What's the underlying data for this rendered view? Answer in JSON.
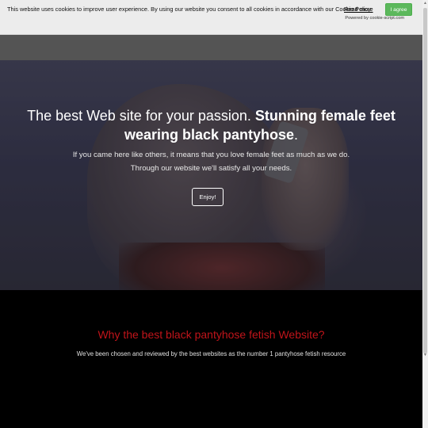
{
  "cookie": {
    "message": "This website uses cookies to improve user experience. By using our website you consent to all cookies in accordance with our Cookie Policy.",
    "read_more": "Read more",
    "agree_label": "I agree",
    "powered_by": "Powered by cookie-script.com"
  },
  "hero": {
    "title_plain": "The best Web site for your passion. ",
    "title_strong": "Stunning female feet wearing black pantyhose",
    "title_end": ".",
    "subtitle_1": "If you came here like others, it means that you love female feet as much as we do.",
    "subtitle_2": "Through our website we'll satisfy all your needs.",
    "cta_label": "Enjoy!"
  },
  "why": {
    "title": "Why the best black pantyhose fetish Website?",
    "text": "We've been chosen and reviewed by the best websites as the number 1 pantyhose fetish resource"
  },
  "colors": {
    "accent_red": "#c0141a",
    "agree_green": "#5cb85c"
  },
  "icons": {
    "scroll_up": "scroll-up-arrow-icon",
    "scroll_down": "scroll-down-arrow-icon"
  }
}
